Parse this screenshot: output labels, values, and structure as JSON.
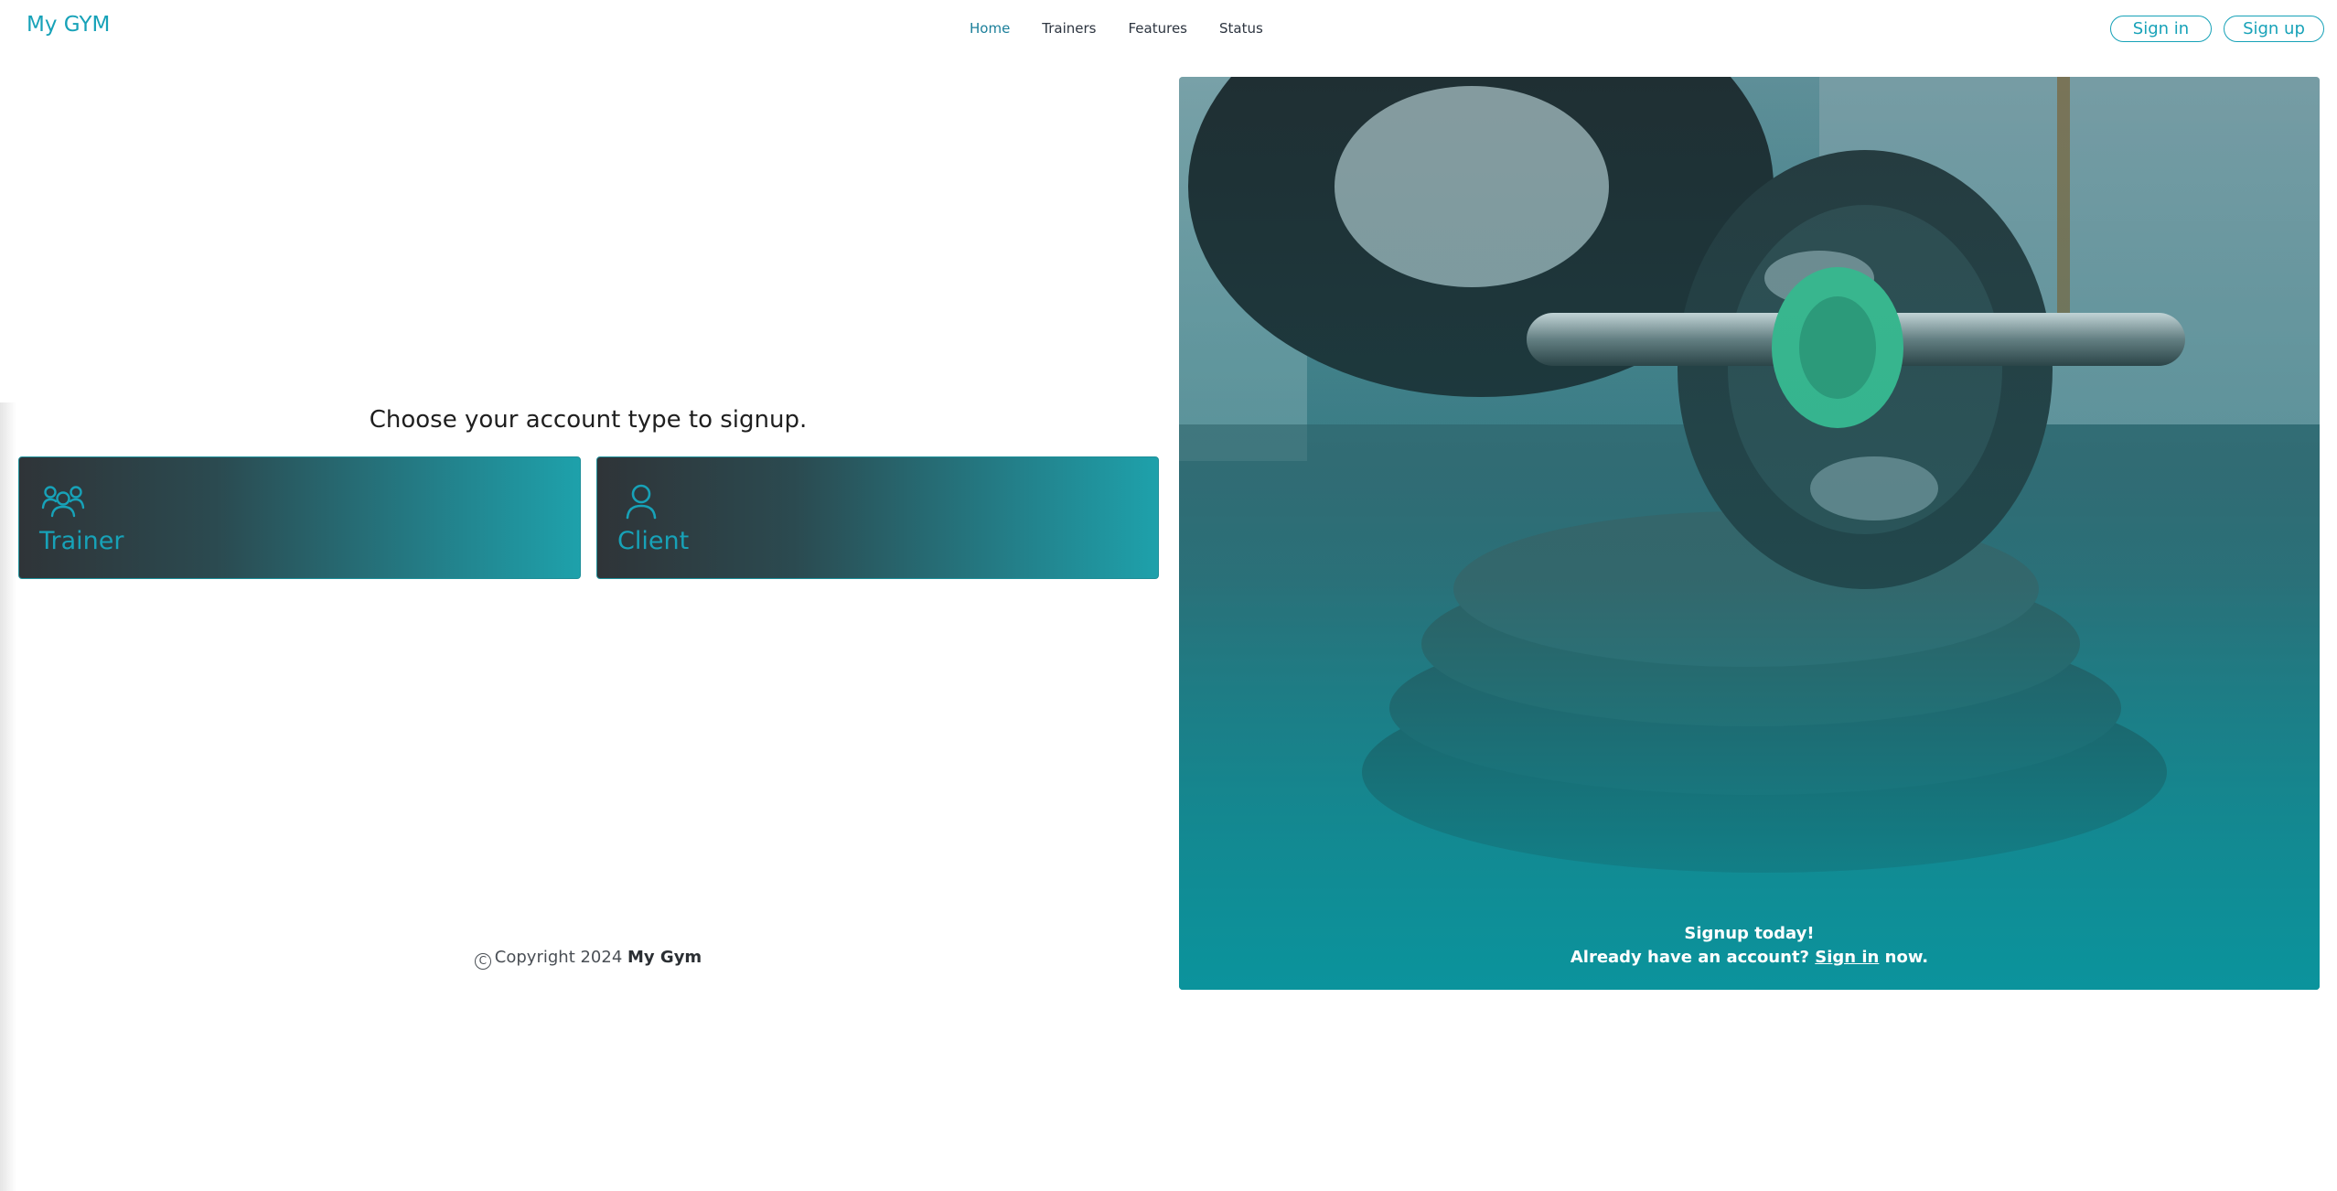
{
  "navbar": {
    "brand": "My GYM",
    "links": [
      "Home",
      "Trainers",
      "Features",
      "Status"
    ],
    "signin_label": "Sign in",
    "signup_label": "Sign up"
  },
  "main": {
    "prompt": "Choose your account type to signup.",
    "cards": [
      {
        "label": "Trainer",
        "icon": "users-icon"
      },
      {
        "label": "Client",
        "icon": "user-icon"
      }
    ]
  },
  "hero": {
    "headline": "Signup today!",
    "subtext_prefix": "Already have an account?",
    "signin_link": "Sign in",
    "subtext_suffix": "now."
  },
  "footer": {
    "copyright_prefix": "Copyright 2024",
    "company": "My Gym"
  },
  "colors": {
    "accent": "#17a2b8",
    "hero_bottom": "#0a959e",
    "card_dark": "#2f3438"
  }
}
